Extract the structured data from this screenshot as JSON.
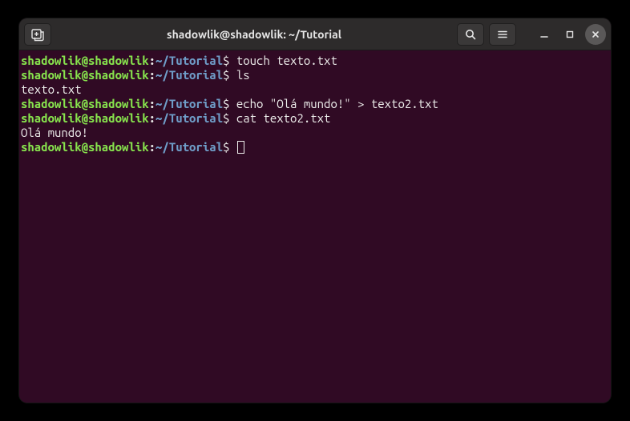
{
  "window": {
    "title": "shadowlik@shadowlik: ~/Tutorial"
  },
  "prompt": {
    "user_host": "shadowlik@shadowlik",
    "colon": ":",
    "path": "~/Tutorial",
    "dollar": "$ "
  },
  "lines": [
    {
      "type": "prompt",
      "cmd": "touch texto.txt"
    },
    {
      "type": "prompt",
      "cmd": "ls"
    },
    {
      "type": "output",
      "text": "texto.txt"
    },
    {
      "type": "prompt",
      "cmd": "echo \"Olá mundo!\" > texto2.txt"
    },
    {
      "type": "prompt",
      "cmd": "cat texto2.txt"
    },
    {
      "type": "output",
      "text": "Olá mundo!"
    },
    {
      "type": "prompt",
      "cmd": "",
      "cursor": true
    }
  ],
  "icons": {
    "new_tab": "new-tab-icon",
    "search": "search-icon",
    "menu": "menu-icon",
    "minimize": "minimize-icon",
    "maximize": "maximize-icon",
    "close": "close-icon"
  }
}
